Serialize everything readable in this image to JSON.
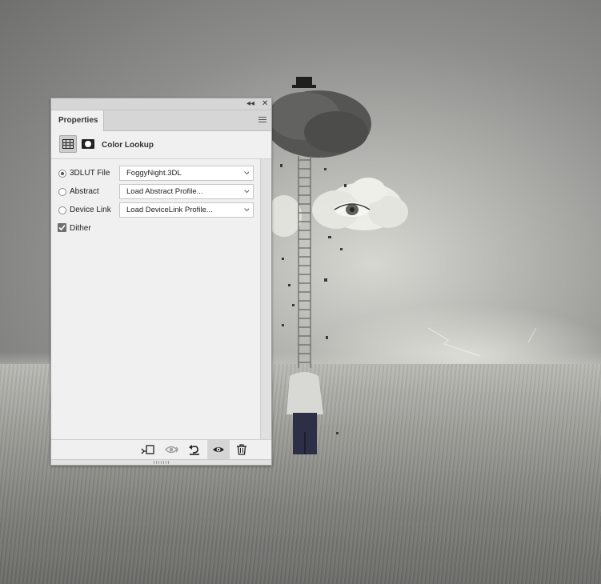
{
  "panel": {
    "tab_label": "Properties",
    "header_title": "Color Lookup",
    "collapse_glyph": "◂◂",
    "close_glyph": "✕"
  },
  "rows": [
    {
      "label": "3DLUT File",
      "value": "FoggyNight.3DL",
      "selected": true
    },
    {
      "label": "Abstract",
      "value": "Load Abstract Profile...",
      "selected": false
    },
    {
      "label": "Device Link",
      "value": "Load DeviceLink Profile...",
      "selected": false
    }
  ],
  "dither": {
    "label": "Dither",
    "checked": true
  },
  "bottom_buttons": [
    "clip-to-layer-icon",
    "view-previous-state-icon",
    "reset-icon",
    "visibility-eye-icon",
    "trash-icon"
  ],
  "colors": {
    "panel_bg": "#f0f0f0",
    "tab_bar": "#d6d6d6",
    "icon_dark": "#222222"
  }
}
